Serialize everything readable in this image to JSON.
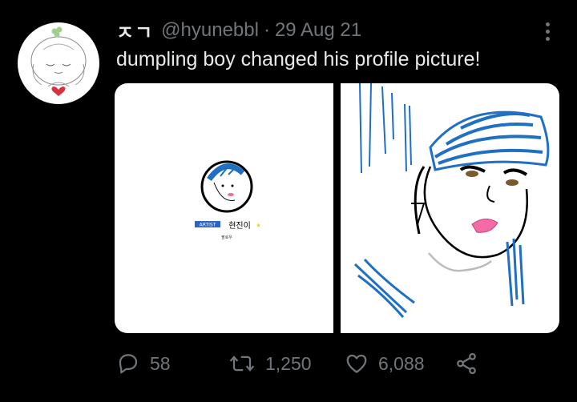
{
  "tweet": {
    "display_name": "ㅈㄱ",
    "handle": "@hyunebbl",
    "separator": "·",
    "date": "29 Aug 21",
    "text": "dumpling boy changed his profile picture!"
  },
  "media": {
    "left_image": {
      "badge": "ARTIST",
      "name": "현진이",
      "caption": "팔로우"
    }
  },
  "actions": {
    "replies": "58",
    "retweets": "1,250",
    "likes": "6,088"
  },
  "colors": {
    "background": "#000000",
    "text": "#e7e9ea",
    "muted": "#71767b",
    "hat_blue": "#1f6fc5"
  },
  "icons": [
    "more-options-icon",
    "reply-icon",
    "retweet-icon",
    "like-icon",
    "share-icon"
  ]
}
